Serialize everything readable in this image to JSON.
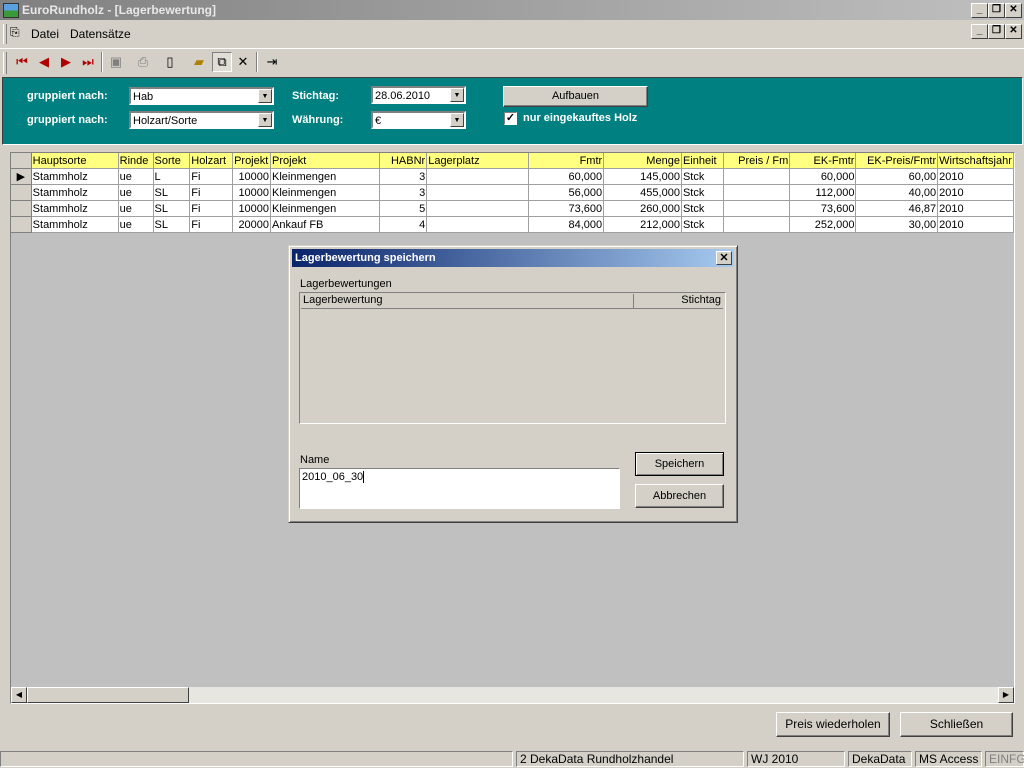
{
  "window": {
    "title": "EuroRundholz - [Lagerbewertung]"
  },
  "menu": {
    "items": [
      "Datei",
      "Datensätze"
    ]
  },
  "filter": {
    "group1_label": "gruppiert nach:",
    "group1_value": "Hab",
    "group2_label": "gruppiert nach:",
    "group2_value": "Holzart/Sorte",
    "stichtag_label": "Stichtag:",
    "stichtag_value": "28.06.2010",
    "waehrung_label": "Währung:",
    "waehrung_value": "€",
    "build_button": "Aufbauen",
    "only_purchased_label": "nur eingekauftes Holz",
    "only_purchased_checked": true
  },
  "grid": {
    "columns": [
      "Hauptsorte",
      "Rinde",
      "Sorte",
      "Holzart",
      "Projekt",
      "Projekt",
      "HABNr",
      "Lagerplatz",
      "Fmtr",
      "Menge",
      "Einheit",
      "Preis / Fm",
      "EK-Fmtr",
      "EK-Preis/Fmtr",
      "Wirtschaftsjahr"
    ],
    "rows": [
      [
        "Stammholz",
        "ue",
        "L",
        "Fi",
        "10000",
        "Kleinmengen",
        "3",
        "",
        "60,000",
        "145,000",
        "Stck",
        "",
        "60,000",
        "60,00",
        "2010"
      ],
      [
        "Stammholz",
        "ue",
        "SL",
        "Fi",
        "10000",
        "Kleinmengen",
        "3",
        "",
        "56,000",
        "455,000",
        "Stck",
        "",
        "112,000",
        "40,00",
        "2010"
      ],
      [
        "Stammholz",
        "ue",
        "SL",
        "Fi",
        "10000",
        "Kleinmengen",
        "5",
        "",
        "73,600",
        "260,000",
        "Stck",
        "",
        "73,600",
        "46,87",
        "2010"
      ],
      [
        "Stammholz",
        "ue",
        "SL",
        "Fi",
        "20000",
        "Ankauf FB",
        "4",
        "",
        "84,000",
        "212,000",
        "Stck",
        "",
        "252,000",
        "30,00",
        "2010"
      ]
    ]
  },
  "dialog": {
    "title": "Lagerbewertung speichern",
    "list_label": "Lagerbewertungen",
    "list_col1": "Lagerbewertung",
    "list_col2": "Stichtag",
    "name_label": "Name",
    "name_value": "2010_06_30",
    "save_button": "Speichern",
    "cancel_button": "Abbrechen"
  },
  "bottom": {
    "repeat_button": "Preis wiederholen",
    "close_button": "Schließen"
  },
  "status": {
    "company": "2 DekaData Rundholzhandel",
    "year": "WJ 2010",
    "user": "DekaData",
    "db": "MS Access",
    "mode": "EINFG"
  }
}
